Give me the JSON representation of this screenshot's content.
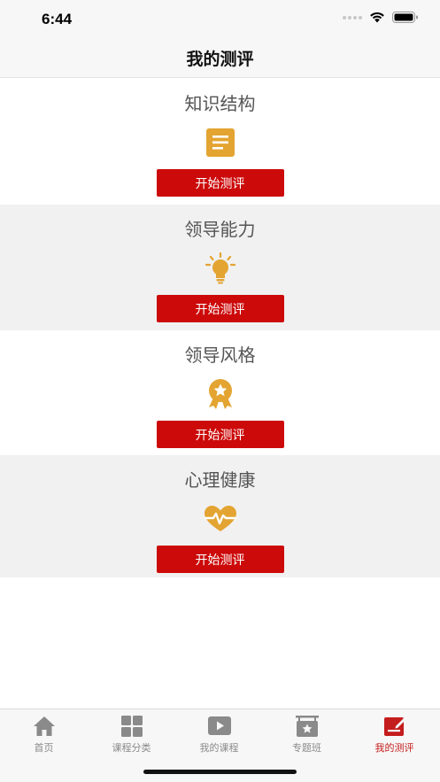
{
  "status_bar": {
    "time": "6:44"
  },
  "nav": {
    "title": "我的测评"
  },
  "assessments": [
    {
      "title": "知识结构",
      "icon": "document-icon",
      "button": "开始测评"
    },
    {
      "title": "领导能力",
      "icon": "lightbulb-icon",
      "button": "开始测评"
    },
    {
      "title": "领导风格",
      "icon": "award-badge-icon",
      "button": "开始测评"
    },
    {
      "title": "心理健康",
      "icon": "heart-pulse-icon",
      "button": "开始测评"
    }
  ],
  "tabs": [
    {
      "label": "首页",
      "icon": "home-icon",
      "active": false
    },
    {
      "label": "课程分类",
      "icon": "grid-icon",
      "active": false
    },
    {
      "label": "我的课程",
      "icon": "play-icon",
      "active": false
    },
    {
      "label": "专题班",
      "icon": "star-board-icon",
      "active": false
    },
    {
      "label": "我的测评",
      "icon": "edit-note-icon",
      "active": true
    }
  ],
  "colors": {
    "accent_red": "#cc0a0a",
    "icon_gold": "#e3a431",
    "active_tab": "#c41d1d",
    "inactive_tab": "#8a8a8a",
    "card_gray": "#f1f1f1"
  }
}
